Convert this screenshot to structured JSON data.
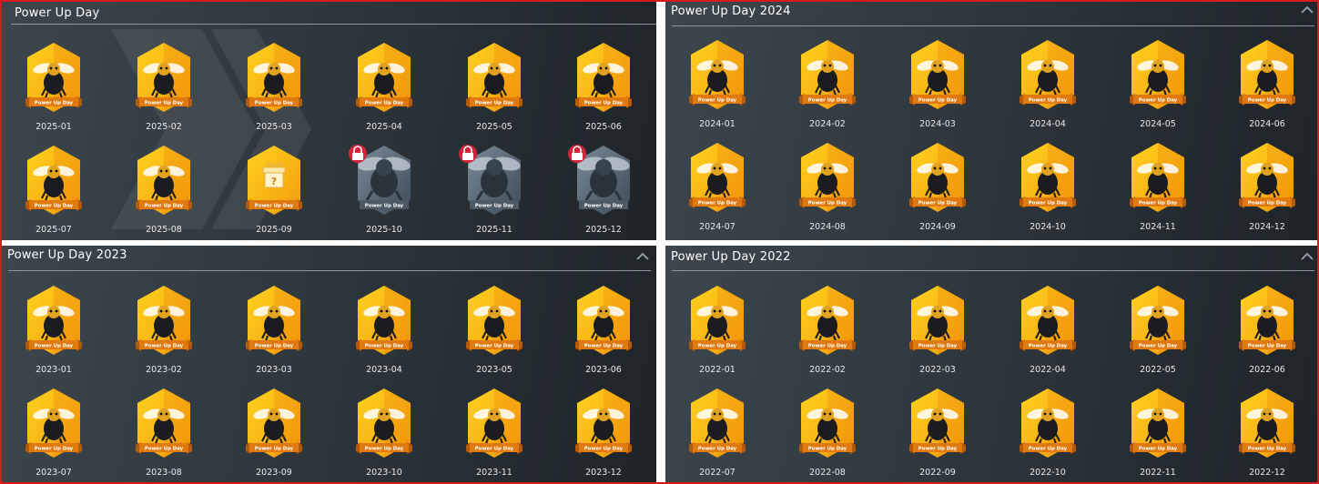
{
  "badge_ribbon_text": "Power Up Day",
  "colors": {
    "frame": "#d41c1c",
    "hex_gold_light": "#ffd21f",
    "hex_gold_dark": "#f29c0c",
    "ribbon": "#e07a10",
    "locked_hex": "#58697a",
    "lock_badge": "#d3243a"
  },
  "panels": [
    {
      "title": "Power Up Day",
      "collapsible": false,
      "badges": [
        {
          "label": "2025-01",
          "state": "earned",
          "icon": "bee-icon"
        },
        {
          "label": "2025-02",
          "state": "earned",
          "icon": "bee-icon"
        },
        {
          "label": "2025-03",
          "state": "earned",
          "icon": "bee-icon"
        },
        {
          "label": "2025-04",
          "state": "earned",
          "icon": "bee-icon"
        },
        {
          "label": "2025-05",
          "state": "earned",
          "icon": "bee-icon"
        },
        {
          "label": "2025-06",
          "state": "earned",
          "icon": "bee-icon"
        },
        {
          "label": "2025-07",
          "state": "earned",
          "icon": "bee-icon"
        },
        {
          "label": "2025-08",
          "state": "earned",
          "icon": "bee-icon"
        },
        {
          "label": "2025-09",
          "state": "mystery",
          "icon": "gift-icon"
        },
        {
          "label": "2025-10",
          "state": "locked",
          "icon": "lock-icon"
        },
        {
          "label": "2025-11",
          "state": "locked",
          "icon": "lock-icon"
        },
        {
          "label": "2025-12",
          "state": "locked",
          "icon": "lock-icon"
        }
      ]
    },
    {
      "title": "Power Up Day 2024",
      "collapsible": true,
      "badges": [
        {
          "label": "2024-01",
          "state": "earned",
          "icon": "bee-icon"
        },
        {
          "label": "2024-02",
          "state": "earned",
          "icon": "bee-icon"
        },
        {
          "label": "2024-03",
          "state": "earned",
          "icon": "bee-icon"
        },
        {
          "label": "2024-04",
          "state": "earned",
          "icon": "bee-icon"
        },
        {
          "label": "2024-05",
          "state": "earned",
          "icon": "bee-icon"
        },
        {
          "label": "2024-06",
          "state": "earned",
          "icon": "bee-icon"
        },
        {
          "label": "2024-07",
          "state": "earned",
          "icon": "bee-icon"
        },
        {
          "label": "2024-08",
          "state": "earned",
          "icon": "bee-icon"
        },
        {
          "label": "2024-09",
          "state": "earned",
          "icon": "bee-icon"
        },
        {
          "label": "2024-10",
          "state": "earned",
          "icon": "bee-icon"
        },
        {
          "label": "2024-11",
          "state": "earned",
          "icon": "bee-icon"
        },
        {
          "label": "2024-12",
          "state": "earned",
          "icon": "bee-icon"
        }
      ]
    },
    {
      "title": "Power Up Day 2023",
      "collapsible": true,
      "badges": [
        {
          "label": "2023-01",
          "state": "earned",
          "icon": "bee-icon"
        },
        {
          "label": "2023-02",
          "state": "earned",
          "icon": "bee-icon"
        },
        {
          "label": "2023-03",
          "state": "earned",
          "icon": "bee-icon"
        },
        {
          "label": "2023-04",
          "state": "earned",
          "icon": "bee-icon"
        },
        {
          "label": "2023-05",
          "state": "earned",
          "icon": "bee-icon"
        },
        {
          "label": "2023-06",
          "state": "earned",
          "icon": "bee-icon"
        },
        {
          "label": "2023-07",
          "state": "earned",
          "icon": "bee-icon"
        },
        {
          "label": "2023-08",
          "state": "earned",
          "icon": "bee-icon"
        },
        {
          "label": "2023-09",
          "state": "earned",
          "icon": "bee-icon"
        },
        {
          "label": "2023-10",
          "state": "earned",
          "icon": "bee-icon"
        },
        {
          "label": "2023-11",
          "state": "earned",
          "icon": "bee-icon"
        },
        {
          "label": "2023-12",
          "state": "earned",
          "icon": "bee-icon"
        }
      ]
    },
    {
      "title": "Power Up Day 2022",
      "collapsible": true,
      "badges": [
        {
          "label": "2022-01",
          "state": "earned",
          "icon": "bee-icon"
        },
        {
          "label": "2022-02",
          "state": "earned",
          "icon": "bee-icon"
        },
        {
          "label": "2022-03",
          "state": "earned",
          "icon": "bee-icon"
        },
        {
          "label": "2022-04",
          "state": "earned",
          "icon": "bee-icon"
        },
        {
          "label": "2022-05",
          "state": "earned",
          "icon": "bee-icon"
        },
        {
          "label": "2022-06",
          "state": "earned",
          "icon": "bee-icon"
        },
        {
          "label": "2022-07",
          "state": "earned",
          "icon": "bee-icon"
        },
        {
          "label": "2022-08",
          "state": "earned",
          "icon": "bee-icon"
        },
        {
          "label": "2022-09",
          "state": "earned",
          "icon": "bee-icon"
        },
        {
          "label": "2022-10",
          "state": "earned",
          "icon": "bee-icon"
        },
        {
          "label": "2022-11",
          "state": "earned",
          "icon": "bee-icon"
        },
        {
          "label": "2022-12",
          "state": "earned",
          "icon": "bee-icon"
        }
      ]
    }
  ]
}
